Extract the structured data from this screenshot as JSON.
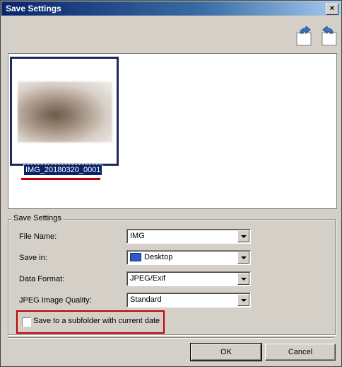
{
  "window": {
    "title": "Save Settings",
    "close_glyph": "×"
  },
  "toolbar": {
    "rotate_left_icon": "rotate-left-icon",
    "rotate_right_icon": "rotate-right-icon"
  },
  "preview": {
    "thumbnail_filename": "IMG_20180320_0001"
  },
  "settings": {
    "group_title": "Save Settings",
    "file_name_label": "File Name:",
    "file_name_value": "IMG",
    "save_in_label": "Save in:",
    "save_in_value": "Desktop",
    "data_format_label": "Data Format:",
    "data_format_value": "JPEG/Exif",
    "quality_label": "JPEG Image Quality:",
    "quality_value": "Standard",
    "subfolder_label": "Save to a subfolder with current date"
  },
  "buttons": {
    "ok": "OK",
    "cancel": "Cancel"
  },
  "colors": {
    "title_bar": "#0a246a",
    "highlight_border": "#c00000",
    "dialog_bg": "#d4d0c8"
  }
}
